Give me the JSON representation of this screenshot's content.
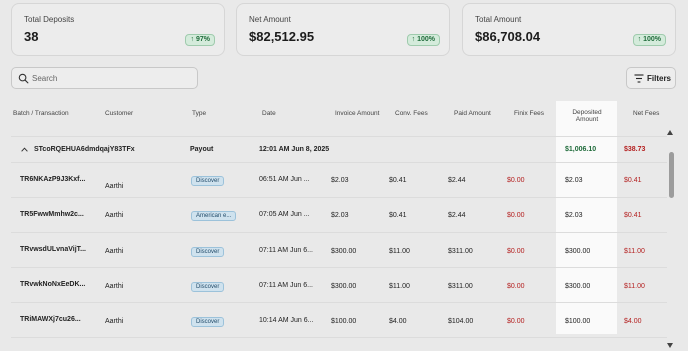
{
  "summary": [
    {
      "label": "Total Deposits",
      "value": "38",
      "badge": "97%"
    },
    {
      "label": "Net Amount",
      "value": "$82,512.95",
      "badge": "100%"
    },
    {
      "label": "Total Amount",
      "value": "$86,708.04",
      "badge": "100%"
    }
  ],
  "search": {
    "placeholder": "Search"
  },
  "filters": {
    "label": "Filters"
  },
  "columns": {
    "batch": "Batch / Transaction",
    "customer": "Customer",
    "type": "Type",
    "date": "Date",
    "invoice": "Invoice Amount",
    "conv": "Conv. Fees",
    "paid": "Paid Amount",
    "finix": "Finix Fees",
    "deposited": "Deposited Amount",
    "net": "Net Fees"
  },
  "group": {
    "id": "STcoRQEHUA6dmdqajY83TFx",
    "type": "Payout",
    "date": "12:01 AM Jun 8, 2025",
    "deposited": "$1,006.10",
    "net": "$38.73"
  },
  "rows": [
    {
      "id": "TR6NKAzP9J3Kxf...",
      "customer": "Aarthi",
      "type": "Discover",
      "date": "06:51 AM Jun ...",
      "invoice": "$2.03",
      "conv": "$0.41",
      "paid": "$2.44",
      "finix": "$0.00",
      "deposited": "$2.03",
      "net": "$0.41"
    },
    {
      "id": "TR5FwwMmhw2c...",
      "customer": "Aarthi",
      "type": "American e...",
      "date": "07:05 AM Jun ...",
      "invoice": "$2.03",
      "conv": "$0.41",
      "paid": "$2.44",
      "finix": "$0.00",
      "deposited": "$2.03",
      "net": "$0.41"
    },
    {
      "id": "TRvwsdULvnaVijT...",
      "customer": "Aarthi",
      "type": "Discover",
      "date": "07:11 AM Jun 6...",
      "invoice": "$300.00",
      "conv": "$11.00",
      "paid": "$311.00",
      "finix": "$0.00",
      "deposited": "$300.00",
      "net": "$11.00"
    },
    {
      "id": "TRvwkNoNxEeDK...",
      "customer": "Aarthi",
      "type": "Discover",
      "date": "07:11 AM Jun 6...",
      "invoice": "$300.00",
      "conv": "$11.00",
      "paid": "$311.00",
      "finix": "$0.00",
      "deposited": "$300.00",
      "net": "$11.00"
    },
    {
      "id": "TRiMAWXj7cu26...",
      "customer": "Aarthi",
      "type": "Discover",
      "date": "10:14 AM Jun 6...",
      "invoice": "$100.00",
      "conv": "$4.00",
      "paid": "$104.00",
      "finix": "$0.00",
      "deposited": "$100.00",
      "net": "$4.00"
    }
  ],
  "colors": {
    "positive": "#1f6b3a",
    "negative": "#b42020",
    "pill": "#cfe2ee"
  }
}
